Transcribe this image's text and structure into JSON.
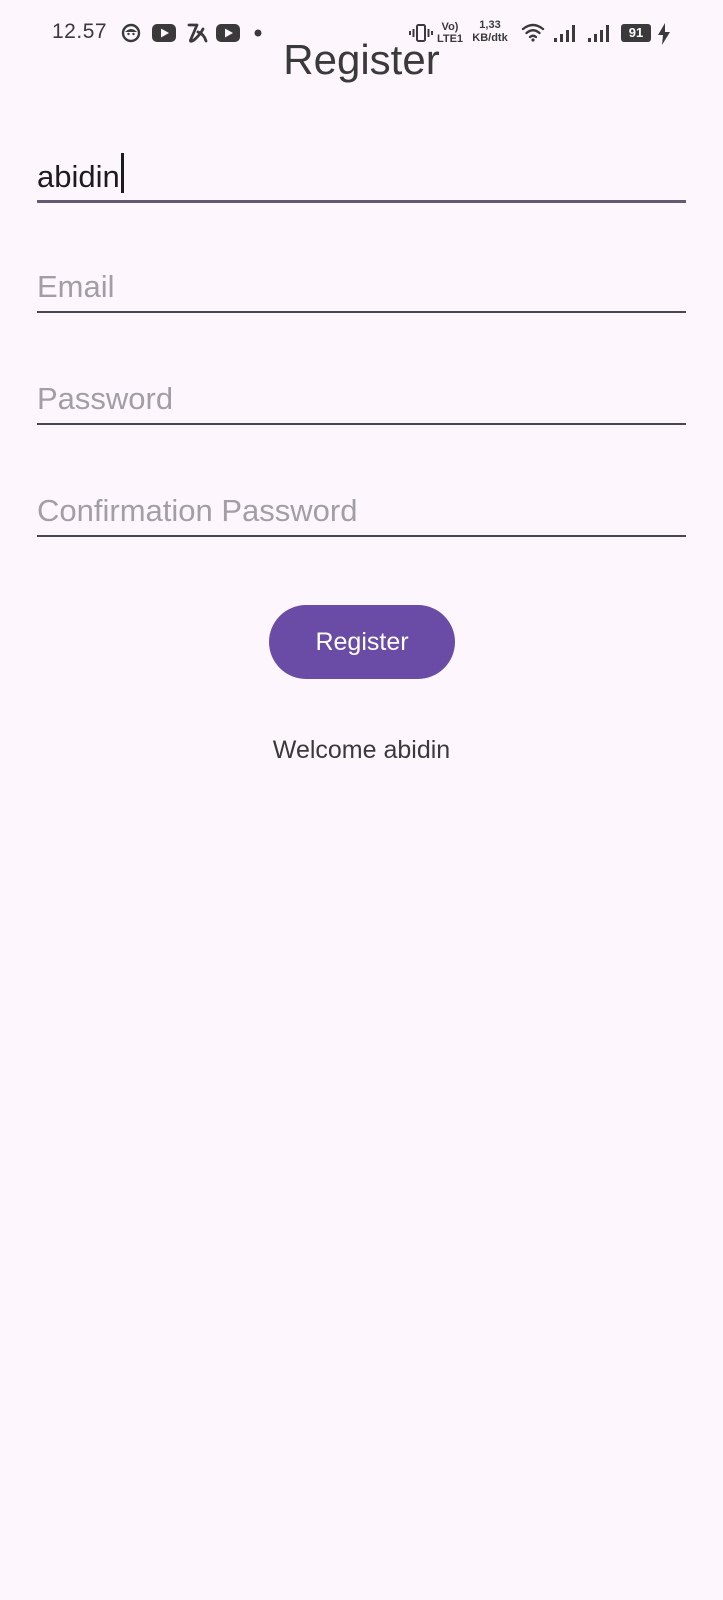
{
  "status_bar": {
    "time": "12.57",
    "volte_label": "Vo)",
    "lte_label": "LTE1",
    "network_speed_value": "1,33",
    "network_speed_unit": "KB/dtk",
    "battery_level": "91",
    "icons": [
      "face-icon",
      "youtube-icon",
      "mi-icon",
      "youtube-icon",
      "dot-icon",
      "vibrate-icon",
      "wifi-icon",
      "signal-icon",
      "signal-icon",
      "charging-icon"
    ]
  },
  "header": {
    "title": "Register"
  },
  "form": {
    "username_value": "abidin",
    "email_placeholder": "Email",
    "password_placeholder": "Password",
    "confirm_password_placeholder": "Confirmation Password",
    "register_label": "Register"
  },
  "welcome_message": "Welcome abidin",
  "colors": {
    "background": "#fdf7fd",
    "accent": "#6a4ba6",
    "underline": "#49454f",
    "placeholder": "#a29ea6"
  }
}
